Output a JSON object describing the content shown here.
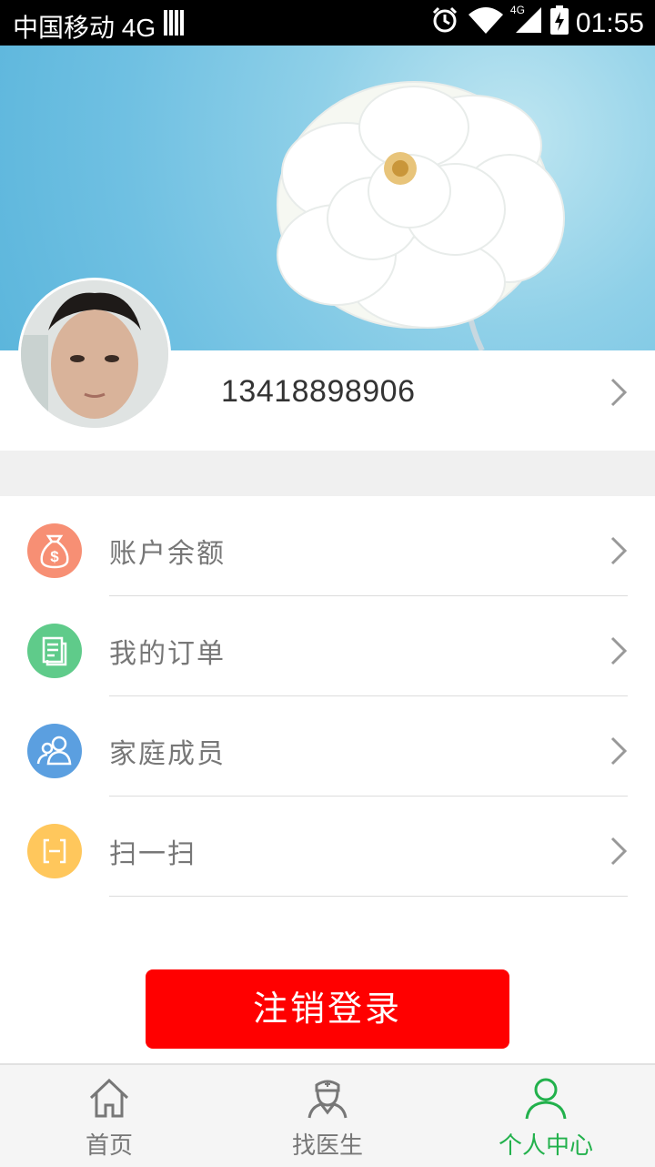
{
  "status_bar": {
    "carrier": "中国移动 4G",
    "network": "4G",
    "time": "01:55"
  },
  "profile": {
    "phone": "13418898906"
  },
  "menu": {
    "items": [
      {
        "label": "账户余额",
        "icon": "money-bag-icon",
        "color": "#f78f74"
      },
      {
        "label": "我的订单",
        "icon": "order-list-icon",
        "color": "#5fcb8a"
      },
      {
        "label": "家庭成员",
        "icon": "family-members-icon",
        "color": "#5b9fe0"
      },
      {
        "label": "扫一扫",
        "icon": "scan-icon",
        "color": "#ffc75c"
      }
    ]
  },
  "logout": {
    "label": "注销登录",
    "color": "#ff0000"
  },
  "tabbar": {
    "tabs": [
      {
        "label": "首页",
        "icon": "home-icon",
        "active": false
      },
      {
        "label": "找医生",
        "icon": "doctor-icon",
        "active": false
      },
      {
        "label": "个人中心",
        "icon": "user-icon",
        "active": true
      }
    ],
    "active_color": "#22b14c"
  }
}
